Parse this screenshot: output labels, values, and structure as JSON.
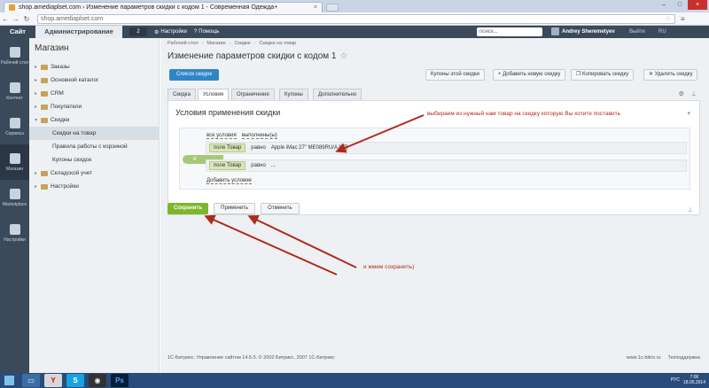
{
  "browser": {
    "tab_title": "shop.amediaplset.com › Изменение параметров скидки с кодом 1 - Современная Одежда+",
    "url": "shop.amediaplset.com",
    "tab_close": "×",
    "minimize": "–",
    "maximize": "□",
    "close": "×"
  },
  "admin_bar": {
    "site": "Сайт",
    "admin": "Администрирование",
    "notifications": "2",
    "settings": "Настройки",
    "help": "Помощь",
    "search_placeholder": "поиск...",
    "user": "Andrey Sheremetyev",
    "logout": "Выйти",
    "lang": "RU"
  },
  "iconbar": [
    {
      "label": "Рабочий стол",
      "icon": "desktop-icon"
    },
    {
      "label": "Контент",
      "icon": "content-icon"
    },
    {
      "label": "Сервисы",
      "icon": "services-icon"
    },
    {
      "label": "Магазин",
      "icon": "shop-icon"
    },
    {
      "label": "Marketplace",
      "icon": "marketplace-icon"
    },
    {
      "label": "Настройки",
      "icon": "gear-icon"
    }
  ],
  "menu": {
    "title": "Магазин",
    "items": [
      {
        "label": "Заказы",
        "level": 0
      },
      {
        "label": "Основной каталог",
        "level": 0
      },
      {
        "label": "CRM",
        "level": 0
      },
      {
        "label": "Покупатели",
        "level": 0
      },
      {
        "label": "Скидки",
        "level": 0
      },
      {
        "label": "Скидки на товар",
        "level": 1
      },
      {
        "label": "Правила работы с корзиной",
        "level": 1
      },
      {
        "label": "Купоны скидок",
        "level": 1
      },
      {
        "label": "Складской учет",
        "level": 0
      },
      {
        "label": "Настройки",
        "level": 0
      }
    ]
  },
  "breadcrumbs": [
    "Рабочий стол",
    "Магазин",
    "Скидки",
    "Скидки на товар"
  ],
  "page_title": "Изменение параметров скидки с кодом 1",
  "toolbar": {
    "list": "Список скидок",
    "coupons": "Купоны этой скидки",
    "add": "Добавить новую скидку",
    "copy": "Копировать скидку",
    "delete": "Удалить скидку"
  },
  "tabs": [
    "Скидка",
    "Условия",
    "Ограничения",
    "Купоны",
    "Дополнительно"
  ],
  "panel": {
    "title": "Условия применения скидки",
    "all_conditions": "все условия",
    "fulfilled": "выполнены(ы)",
    "and": "И",
    "rows": [
      {
        "field": "поле Товар",
        "op": "равно",
        "value": "Apple iMac 27\" ME089RU/A [17]"
      },
      {
        "field": "поле Товар",
        "op": "равно",
        "value": "..."
      }
    ],
    "add_condition": "Добавить условие"
  },
  "actions": {
    "save": "Сохранить",
    "apply": "Применить",
    "cancel": "Отменить"
  },
  "annotations": {
    "top": "выбираем из нужный нам товар на скидку которую Вы хотите поставить",
    "bottom": "и жмем сохранить)"
  },
  "footer": {
    "left": "1С-Битрикс: Управление сайтом 14.5.0. © 2002 Битрикс, 2007 1С-Битрикс",
    "site": "www.1c-bitrix.ru",
    "support": "Техподдержка"
  },
  "taskbar": {
    "time": "7:06",
    "date": "18.05.2014",
    "lang": "РУС"
  },
  "colors": {
    "accent": "#2f86c6",
    "save": "#7fb52e",
    "annotation": "#b02a1c",
    "sidebar": "#3b4a5a"
  }
}
